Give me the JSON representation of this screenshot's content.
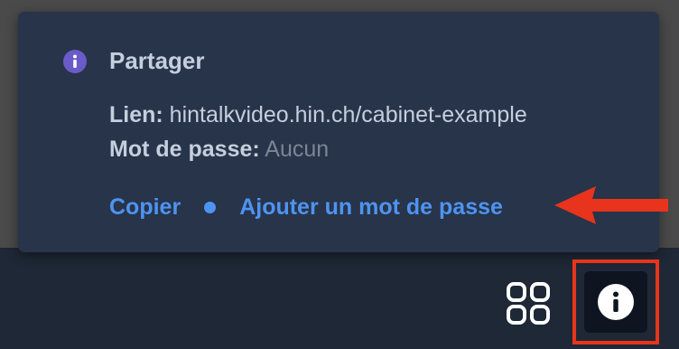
{
  "popup": {
    "icon": "info-circle-icon",
    "title": "Partager",
    "link": {
      "label": "Lien:",
      "value": "hintalkvideo.hin.ch/cabinet-example"
    },
    "password": {
      "label": "Mot de passe:",
      "value": "Aucun"
    },
    "actions": {
      "copy_label": "Copier",
      "add_password_label": "Ajouter un mot de passe"
    }
  },
  "annotation": {
    "arrow_color": "#e8341c",
    "highlight_color": "#e8341c"
  },
  "toolbar": {
    "grid_icon": "grid-view-icon",
    "info_icon": "info-circle-icon"
  },
  "colors": {
    "accent": "#4f93f0",
    "info_purple": "#6b5bc8",
    "popup_bg": "#27344a",
    "toolbar_bg": "#1e2836"
  }
}
